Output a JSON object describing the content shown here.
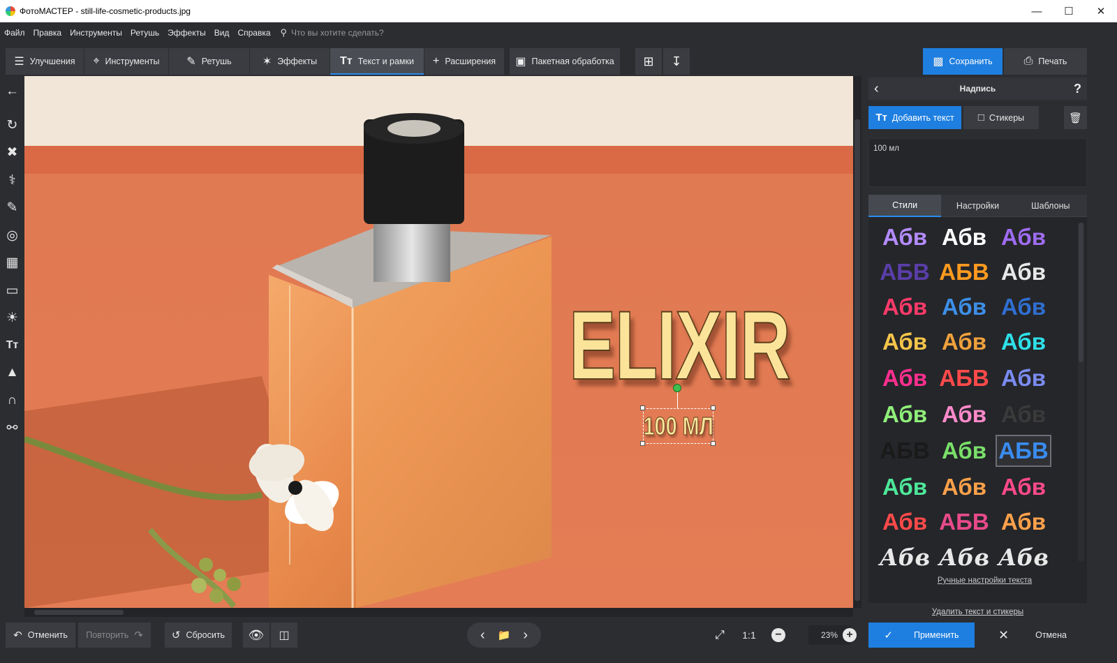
{
  "window": {
    "title": "ФотоМАСТЕР - still-life-cosmetic-products.jpg",
    "minimize": "—",
    "maximize": "☐",
    "close": "✕"
  },
  "menu": {
    "items": [
      "Файл",
      "Правка",
      "Инструменты",
      "Ретушь",
      "Эффекты",
      "Вид",
      "Справка"
    ],
    "search_placeholder": "Что вы хотите сделать?"
  },
  "toolbar": {
    "improvements": "Улучшения",
    "tools": "Инструменты",
    "retouch": "Ретушь",
    "effects": "Эффекты",
    "text_frames": "Текст и рамки",
    "extensions": "Расширения",
    "batch": "Пакетная обработка",
    "save": "Сохранить",
    "print": "Печать"
  },
  "canvas": {
    "main_text": "ELIXIR",
    "sub_text": "100 МЛ"
  },
  "panel": {
    "title": "Надпись",
    "help": "?",
    "add_text": "Добавить текст",
    "stickers": "Стикеры",
    "text_value": "100 мл",
    "tabs": [
      "Стили",
      "Настройки",
      "Шаблоны"
    ],
    "active_tab": "Стили",
    "manual_settings": "Ручные настройки текста",
    "delete_all": "Удалить текст и стикеры"
  },
  "styles": [
    {
      "text": "Абв",
      "color": "#b48cff"
    },
    {
      "text": "Абв",
      "color": "#ffffff"
    },
    {
      "text": "Абв",
      "color": "#9f6cf0"
    },
    {
      "text": "АБВ",
      "color": "#5a3ea8"
    },
    {
      "text": "АБВ",
      "color": "#ff9a1f"
    },
    {
      "text": "Абв",
      "color": "#e8e8e8"
    },
    {
      "text": "Абв",
      "color": "#ff3a6a"
    },
    {
      "text": "Абв",
      "color": "#3d8fe8"
    },
    {
      "text": "Абв",
      "color": "#2f6fd0"
    },
    {
      "text": "Абв",
      "color": "#f5c54a"
    },
    {
      "text": "Абв",
      "color": "#f0a13c"
    },
    {
      "text": "Абв",
      "color": "#2ee0e8"
    },
    {
      "text": "Абв",
      "color": "#ff2f8f"
    },
    {
      "text": "АБВ",
      "color": "#ff4a4a"
    },
    {
      "text": "Абв",
      "color": "#7a8cf0"
    },
    {
      "text": "Абв",
      "color": "#8ff07a"
    },
    {
      "text": "Абв",
      "color": "#ff8acb"
    },
    {
      "text": "Абв",
      "color": "#3a3a3a"
    },
    {
      "text": "АБВ",
      "color": "#1a1a1a"
    },
    {
      "text": "Абв",
      "color": "#7ae06a"
    },
    {
      "text": "АБВ",
      "color": "#3a8cf0"
    },
    {
      "text": "Абв",
      "color": "#4de89a"
    },
    {
      "text": "Абв",
      "color": "#ffa14a"
    },
    {
      "text": "Абв",
      "color": "#ff4a8a"
    },
    {
      "text": "Абв",
      "color": "#ff4a4a"
    },
    {
      "text": "АБВ",
      "color": "#e84a8a"
    },
    {
      "text": "Абв",
      "color": "#ffa14a"
    },
    {
      "text": "Абв",
      "color": "#e8e8e8"
    },
    {
      "text": "Абв",
      "color": "#e8e8e8"
    },
    {
      "text": "Абв",
      "color": "#e8e8e8"
    }
  ],
  "bottom": {
    "undo": "Отменить",
    "redo": "Повторить",
    "reset": "Сбросить",
    "ratio": "1:1",
    "zoom": "23%",
    "apply": "Применить",
    "cancel": "Отмена"
  },
  "colors": {
    "accent": "#1e7fe0",
    "panel_bg": "#2b2d31",
    "canvas_orange": "#e47c55",
    "elixir_yellow": "#fbe49a"
  }
}
